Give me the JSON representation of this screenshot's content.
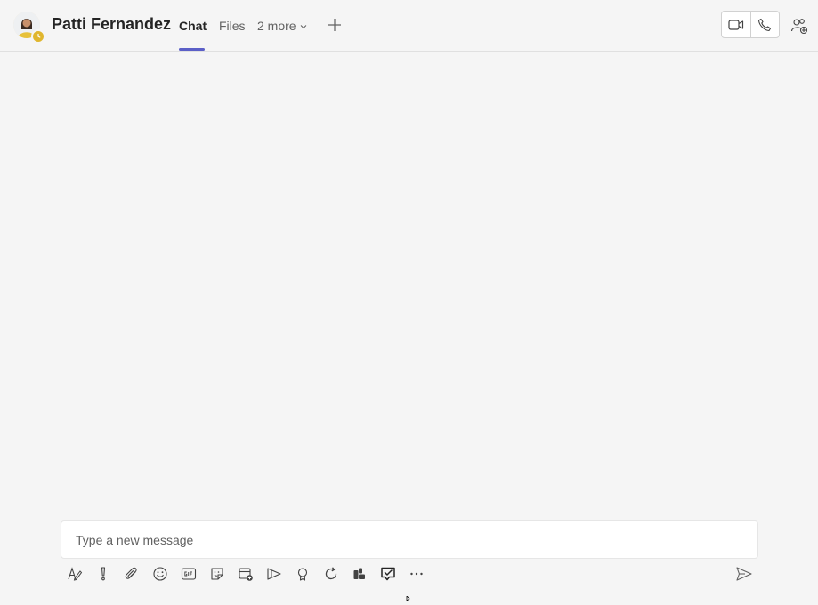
{
  "header": {
    "contact_name": "Patti Fernandez",
    "tabs": [
      {
        "label": "Chat",
        "active": true
      },
      {
        "label": "Files",
        "active": false
      },
      {
        "label": "2 more",
        "active": false
      }
    ],
    "add_tab_icon": "plus-icon",
    "call_buttons": [
      "video-call-icon",
      "audio-call-icon"
    ],
    "people_icon": "add-people-icon"
  },
  "compose": {
    "placeholder": "Type a new message",
    "value": ""
  },
  "toolbar": {
    "items": [
      "format-icon",
      "important-icon",
      "attach-icon",
      "emoji-icon",
      "gif-icon",
      "sticker-icon",
      "schedule-meeting-icon",
      "stream-icon",
      "praise-icon",
      "loop-icon",
      "apps-icon",
      "approvals-icon",
      "more-options-icon"
    ],
    "send_icon": "send-icon"
  },
  "colors": {
    "background": "#f5f5f5",
    "accent": "#5b5fc7",
    "presence_away": "#e0b62e"
  }
}
